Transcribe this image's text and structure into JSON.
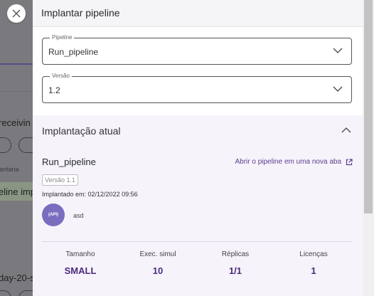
{
  "background": {
    "text_1": "receivin",
    "label_1": "antana",
    "text_2": "eline imp",
    "text_3": "day-20-s"
  },
  "drawer": {
    "title": "Implantar pipeline",
    "close_icon": "close-icon",
    "pipeline_field": {
      "legend": "Pipeline",
      "value": "Run_pipeline"
    },
    "version_field": {
      "legend": "Versão",
      "value": "1.2"
    },
    "current_deployment": {
      "title": "Implantação atual",
      "pipeline_name": "Run_pipeline",
      "open_link": "Abrir o pipeline em uma nova aba",
      "version_badge": "Versão 1.1",
      "deployed_at": "Implantado em: 02/12/2022 09:56",
      "avatar_text": "(API)",
      "user": "asd",
      "stats": [
        {
          "label": "Tamanho",
          "value": "SMALL"
        },
        {
          "label": "Exec. simul",
          "value": "10"
        },
        {
          "label": "Réplicas",
          "value": "1/1"
        },
        {
          "label": "Licenças",
          "value": "1"
        }
      ]
    }
  },
  "colors": {
    "accent": "#5a3e8c",
    "avatar": "#7a6dc0",
    "section_bg": "#f6f3fb"
  }
}
